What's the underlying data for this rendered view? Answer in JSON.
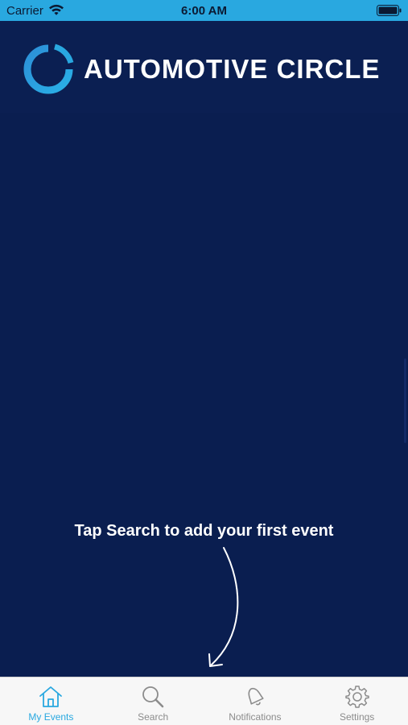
{
  "status_bar": {
    "carrier": "Carrier",
    "time": "6:00 AM",
    "icons": [
      "wifi-icon",
      "battery-icon"
    ]
  },
  "header": {
    "logo_text": "AUTOMOTIVE CIRCLE",
    "logo_icon": "circle-logo-icon"
  },
  "main": {
    "hint": "Tap Search to add your first event",
    "hint_icon": "curved-arrow-down-icon"
  },
  "tab_bar": {
    "active_index": 0,
    "tabs": [
      {
        "label": "My Events",
        "icon": "house-icon"
      },
      {
        "label": "Search",
        "icon": "magnifier-icon"
      },
      {
        "label": "Notifications",
        "icon": "bell-icon"
      },
      {
        "label": "Settings",
        "icon": "gear-icon"
      }
    ]
  },
  "colors": {
    "background": "#0b1f52",
    "accent": "#29a8e0",
    "tab_inactive": "#8c8c8c",
    "tab_bar_bg": "#f7f7f7"
  }
}
